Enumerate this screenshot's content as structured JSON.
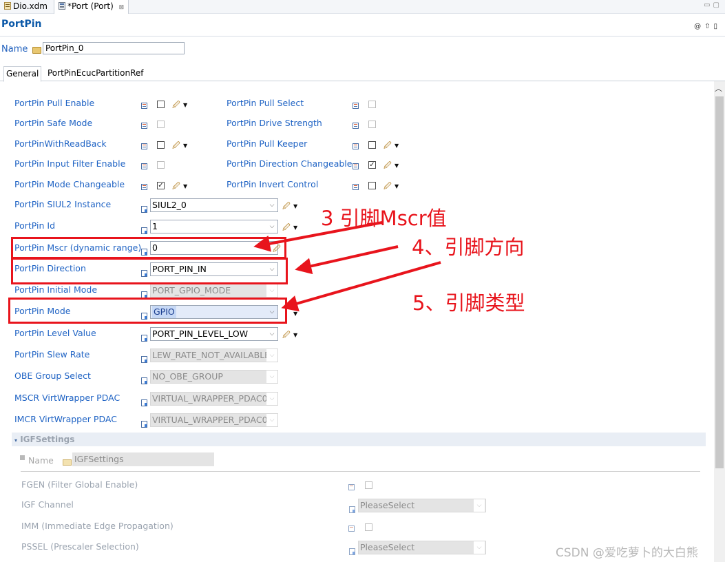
{
  "tabs": {
    "dio": "Dio.xdm",
    "port": "*Port (Port)",
    "close_glyph": "⊠"
  },
  "header": {
    "title": "PortPin",
    "name_label": "Name",
    "name_value": "PortPin_0"
  },
  "page_tabs": {
    "general": "General",
    "ecuc": "PortPinEcucPartitionRef"
  },
  "left_fields": [
    {
      "label": "PortPin Pull Enable",
      "type": "checkbox",
      "checked": false
    },
    {
      "label": "PortPin Safe Mode",
      "type": "checkbox",
      "checked": false,
      "disabled": true
    },
    {
      "label": "PortPinWithReadBack",
      "type": "checkbox",
      "checked": false
    },
    {
      "label": "PortPin Input Filter Enable",
      "type": "checkbox",
      "checked": false,
      "disabled": true
    },
    {
      "label": "PortPin Mode Changeable",
      "type": "checkbox",
      "checked": true
    },
    {
      "label": "PortPin SIUL2 Instance",
      "type": "combo",
      "value": "SIUL2_0"
    },
    {
      "label": "PortPin Id",
      "type": "combo",
      "value": "1"
    },
    {
      "label": "PortPin Mscr (dynamic range)",
      "type": "combo",
      "value": "0"
    },
    {
      "label": "PortPin Direction",
      "type": "combo",
      "value": "PORT_PIN_IN"
    },
    {
      "label": "PortPin Initial Mode",
      "type": "combo",
      "value": "PORT_GPIO_MODE",
      "disabled": true
    },
    {
      "label": "PortPin Mode",
      "type": "combo",
      "value": "GPIO"
    },
    {
      "label": "PortPin Level Value",
      "type": "combo",
      "value": "PORT_PIN_LEVEL_LOW"
    },
    {
      "label": "PortPin Slew Rate",
      "type": "combo",
      "value": "LEW_RATE_NOT_AVAILABLE",
      "disabled": true
    },
    {
      "label": "OBE Group Select",
      "type": "combo",
      "value": "NO_OBE_GROUP",
      "disabled": true
    },
    {
      "label": "MSCR VirtWrapper PDAC",
      "type": "combo",
      "value": "VIRTUAL_WRAPPER_PDAC0",
      "disabled": true
    },
    {
      "label": "IMCR VirtWrapper PDAC",
      "type": "combo",
      "value": "VIRTUAL_WRAPPER_PDAC0",
      "disabled": true
    }
  ],
  "right_fields": [
    {
      "label": "PortPin Pull Select",
      "type": "checkbox",
      "checked": false,
      "disabled": true
    },
    {
      "label": "PortPin Drive Strength",
      "type": "checkbox",
      "checked": false,
      "disabled": true
    },
    {
      "label": "PortPin Pull Keeper",
      "type": "checkbox",
      "checked": false
    },
    {
      "label": "PortPin Direction Changeable",
      "type": "checkbox",
      "checked": true
    },
    {
      "label": "PortPin Invert Control",
      "type": "checkbox",
      "checked": false
    }
  ],
  "igf_section": {
    "title": "IGFSettings",
    "name_label": "Name",
    "name_value": "IGFSettings",
    "fields": [
      {
        "label": "FGEN (Filter Global Enable)",
        "type": "checkbox"
      },
      {
        "label": "IGF Channel",
        "type": "combo",
        "value": "PleaseSelect"
      },
      {
        "label": "IMM (Immediate Edge Propagation)",
        "type": "checkbox"
      },
      {
        "label": "PSSEL (Prescaler Selection)",
        "type": "combo",
        "value": "PleaseSelect"
      }
    ]
  },
  "annotations": [
    {
      "text": "3 引脚Mscr值"
    },
    {
      "text": "4、引脚方向"
    },
    {
      "text": "5、引脚类型"
    }
  ],
  "watermark": "CSDN @爱吃萝卜的大白熊",
  "glyphs": {
    "check": "✓",
    "chevron": "⌵",
    "pen": "🖉",
    "menu_arrow": "▼"
  },
  "colors": {
    "accent": "#1f63c4",
    "annotation": "#e8141c",
    "disabled": "#a7a7a7"
  }
}
